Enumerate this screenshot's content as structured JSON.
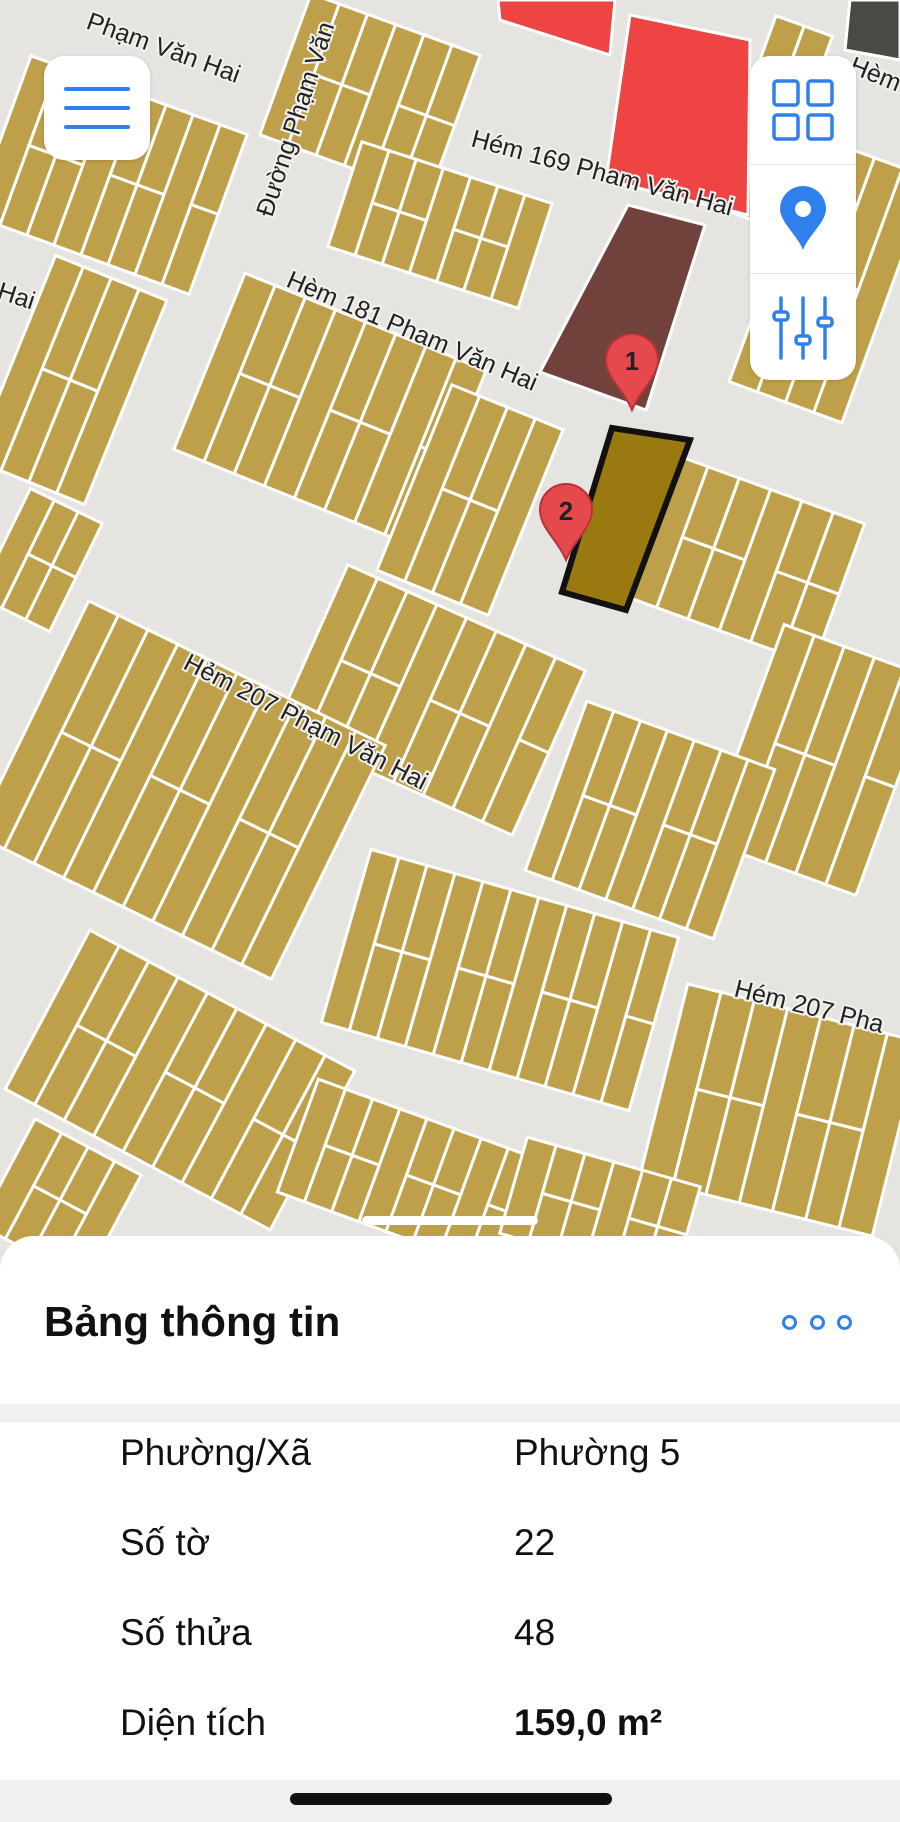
{
  "map": {
    "road_labels": [
      "Phạm Văn Hai",
      "Đường Phạm Văn",
      "Hém 169 Pham Văn Hai",
      "Hèm 181 Pham Văn Hai",
      "Hẻm 207 Phạm Văn Hai",
      "Hém 207 Pha",
      "Hai",
      "Hèm"
    ],
    "pins": [
      "1",
      "2"
    ],
    "colors": {
      "parcel": "#bfa04a",
      "road": "#e6e4e0",
      "selected_parcel": "#9a7a10",
      "highlight_red": "#ef4444",
      "dark_parcel": "#6b3a34",
      "pin": "#e5484d",
      "accent": "#2f80ed"
    }
  },
  "controls": {
    "menu_icon": "hamburger-icon",
    "layers_icon": "grid-icon",
    "locate_icon": "location-pin-icon",
    "filter_icon": "sliders-icon"
  },
  "sheet": {
    "title": "Bảng thông tin",
    "more_icon": "more-icon",
    "rows": [
      {
        "label": "Phường/Xã",
        "value": "Phường 5"
      },
      {
        "label": "Số tờ",
        "value": "22"
      },
      {
        "label": "Số thửa",
        "value": "48"
      },
      {
        "label": "Diện tích",
        "value": "159,0 m²"
      }
    ]
  }
}
